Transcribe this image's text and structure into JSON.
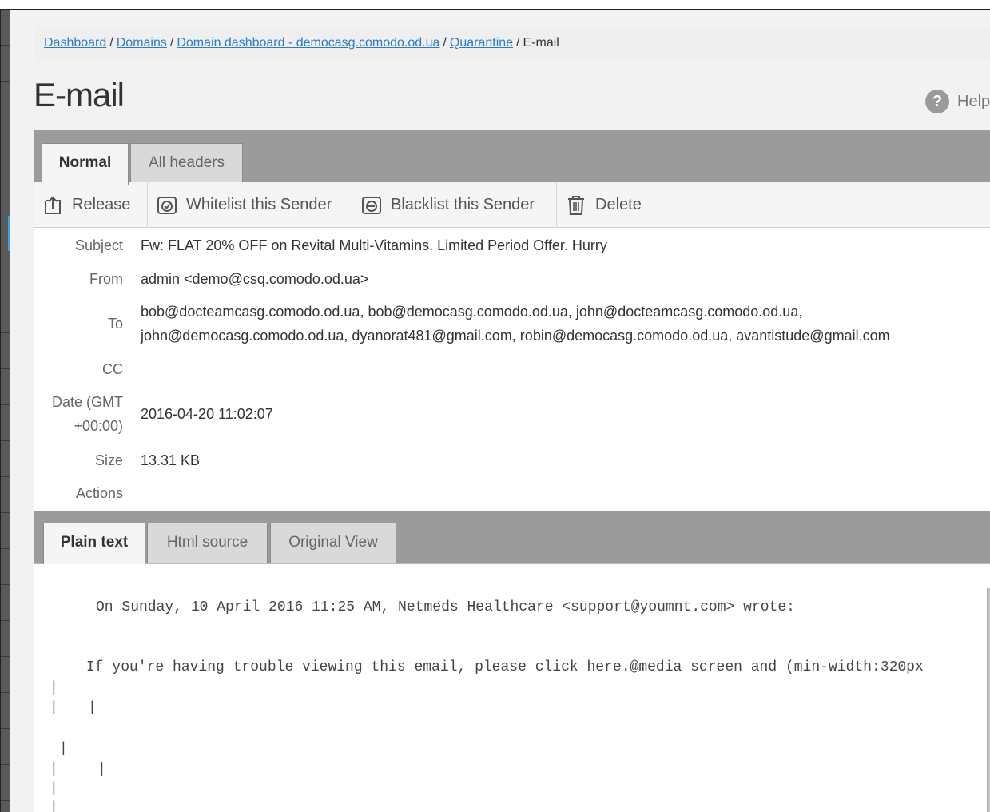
{
  "breadcrumb": {
    "items": [
      {
        "label": "Dashboard",
        "link": true
      },
      {
        "label": "Domains",
        "link": true
      },
      {
        "label": "Domain dashboard - democasg.comodo.od.ua",
        "link": true
      },
      {
        "label": "Quarantine",
        "link": true
      },
      {
        "label": "E-mail",
        "link": false
      }
    ],
    "separator": "/"
  },
  "page": {
    "title": "E-mail",
    "help_label": "Help",
    "help_icon": "question-circle-icon"
  },
  "top_tabs": [
    {
      "label": "Normal",
      "active": true
    },
    {
      "label": "All headers",
      "active": false
    }
  ],
  "toolbar": {
    "release_label": "Release",
    "whitelist_label": "Whitelist this Sender",
    "blacklist_label": "Blacklist this Sender",
    "delete_label": "Delete"
  },
  "details": {
    "subject_label": "Subject",
    "subject_value": "Fw: FLAT 20% OFF on Revital Multi-Vitamins. Limited Period Offer. Hurry",
    "from_label": "From",
    "from_value": "admin <demo@csq.comodo.od.ua>",
    "to_label": "To",
    "to_line1": "bob@docteamcasg.comodo.od.ua, bob@democasg.comodo.od.ua, john@docteamcasg.comodo.od.ua,",
    "to_line2": "john@democasg.comodo.od.ua, dyanorat481@gmail.com, robin@democasg.comodo.od.ua, avantistude@gmail.com",
    "cc_label": "CC",
    "cc_value": "",
    "date_label_line1": "Date (GMT",
    "date_label_line2": "+00:00)",
    "date_value": "2016-04-20 11:02:07",
    "size_label": "Size",
    "size_value": "13.31 KB",
    "actions_label": "Actions"
  },
  "body_tabs": [
    {
      "label": "Plain text",
      "active": true
    },
    {
      "label": "Html source",
      "active": false
    },
    {
      "label": "Original View",
      "active": false
    }
  ],
  "body": {
    "line1": "On Sunday, 10 April 2016 11:25 AM, Netmeds Healthcare <support@youmnt.com> wrote:",
    "line2": "If you're having trouble viewing this email, please click here.@media screen and (min-width:320px",
    "pipe": "|"
  },
  "colors": {
    "link": "#2a7cc7",
    "tabstrip": "#9b9b9b",
    "side_handle": "#3aa0e6"
  }
}
